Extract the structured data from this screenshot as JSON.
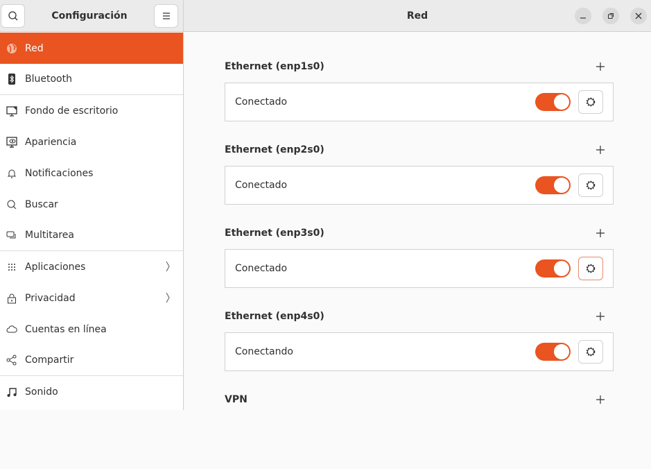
{
  "sidebar": {
    "title": "Configuración",
    "items": [
      {
        "label": "Red",
        "icon": "globe-icon"
      },
      {
        "label": "Bluetooth",
        "icon": "bluetooth-icon"
      },
      {
        "label": "Fondo de escritorio",
        "icon": "wallpaper-icon"
      },
      {
        "label": "Apariencia",
        "icon": "appearance-icon"
      },
      {
        "label": "Notificaciones",
        "icon": "bell-icon"
      },
      {
        "label": "Buscar",
        "icon": "search-icon"
      },
      {
        "label": "Multitarea",
        "icon": "multitasking-icon"
      },
      {
        "label": "Aplicaciones",
        "icon": "apps-grid-icon"
      },
      {
        "label": "Privacidad",
        "icon": "lock-icon"
      },
      {
        "label": "Cuentas en línea",
        "icon": "cloud-icon"
      },
      {
        "label": "Compartir",
        "icon": "share-icon"
      },
      {
        "label": "Sonido",
        "icon": "music-note-icon"
      }
    ]
  },
  "header": {
    "title": "Red"
  },
  "sections": [
    {
      "title": "Ethernet (enp1s0)",
      "status": "Conectado",
      "enabled": true
    },
    {
      "title": "Ethernet (enp2s0)",
      "status": "Conectado",
      "enabled": true
    },
    {
      "title": "Ethernet (enp3s0)",
      "status": "Conectado",
      "enabled": true
    },
    {
      "title": "Ethernet (enp4s0)",
      "status": "Conectando",
      "enabled": true
    },
    {
      "title": "VPN"
    }
  ],
  "colors": {
    "accent": "#e95420"
  }
}
